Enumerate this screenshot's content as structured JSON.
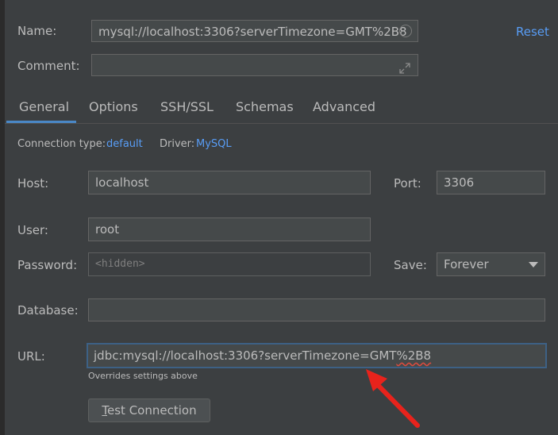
{
  "header": {
    "name_label": "Name:",
    "name_value": "mysql://localhost:3306?serverTimezone=GMT%2B8",
    "reset_label": "Reset",
    "comment_label": "Comment:",
    "comment_value": ""
  },
  "tabs": [
    {
      "label": "General",
      "active": true
    },
    {
      "label": "Options"
    },
    {
      "label": "SSH/SSL"
    },
    {
      "label": "Schemas"
    },
    {
      "label": "Advanced"
    }
  ],
  "general": {
    "connection_type_label": "Connection type:",
    "connection_type_value": "default",
    "driver_label": "Driver:",
    "driver_value": "MySQL",
    "host_label": "Host:",
    "host_value": "localhost",
    "port_label": "Port:",
    "port_value": "3306",
    "user_label": "User:",
    "user_value": "root",
    "password_label": "Password:",
    "password_placeholder": "<hidden>",
    "save_label": "Save:",
    "save_value": "Forever",
    "database_label": "Database:",
    "database_value": "",
    "url_label": "URL:",
    "url_prefix": "jdbc:mysql://localhost:3306?serverTimezone=GMT",
    "url_suffix": "%2B8",
    "url_hint": "Overrides settings above",
    "test_button_mnemonic": "T",
    "test_button_rest": "est Connection"
  },
  "colors": {
    "background": "#3c3f41",
    "link": "#589df6",
    "tab_accent": "#4a88c7",
    "annotation_arrow": "#e8231c"
  }
}
